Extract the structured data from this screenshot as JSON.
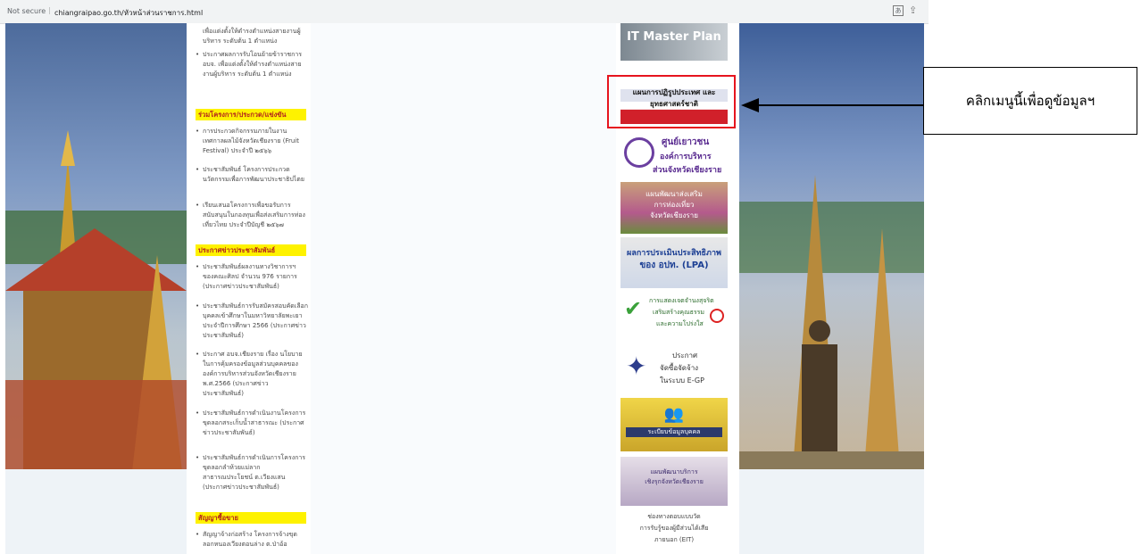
{
  "browser": {
    "security": "Not secure",
    "url": "chiangraipao.go.th/หัวหน้าส่วนราชการ.html"
  },
  "left_column": {
    "top_items": [
      "เพื่อแต่งตั้งให้ดำรงตำแหน่งสายงานผู้บริหาร ระดับต้น 1 ตำแหน่ง",
      "ประกาศผลการรับโอนย้ายข้าราชการ อบจ. เพื่อแต่งตั้งให้ดำรงตำแหน่งสายงานผู้บริหาร ระดับต้น 1 ตำแหน่ง"
    ],
    "section1": "ร่วมโครงการ/ประกวด/แข่งขัน",
    "section1_items": [
      "การประกวดกิจกรรมภายในงานเทศกาลผลไม้จังหวัดเชียงราย (Fruit Festival) ประจำปี ๒๕๖๖",
      "ประชาสัมพันธ์ โครงการประกวดนวัตกรรมเพื่อการพัฒนาประชาธิปไตย",
      "เรียนเสนอโครงการเพื่อขอรับการสนับสนุนในกองทุนเพื่อส่งเสริมการท่องเที่ยวไทย ประจำปีบัญชี ๒๕๖๗"
    ],
    "section2": "ประกาศข่าวประชาสัมพันธ์",
    "section2_items": [
      "ประชาสัมพันธ์ผลงานทางวิชาการฯ ของคณะศิลป จำนวน 976 รายการ (ประกาศข่าวประชาสัมพันธ์)",
      "ประชาสัมพันธ์การรับสมัครสอบคัดเลือกบุคคลเข้าศึกษาในมหาวิทยาลัยพะเยา ประจำปีการศึกษา 2566 (ประกาศข่าวประชาสัมพันธ์)",
      "ประกาศ อบจ.เชียงราย เรื่อง นโยบายในการคุ้มครองข้อมูลส่วนบุคคลขององค์การบริหารส่วนจังหวัดเชียงราย พ.ศ.2566 (ประกาศข่าวประชาสัมพันธ์)",
      "ประชาสัมพันธ์การดำเนินงานโครงการขุดลอกสระเก็บน้ำสาธารณะ (ประกาศข่าวประชาสัมพันธ์)",
      "ประชาสัมพันธ์การดำเนินการโครงการขุดลอกลำห้วยแม่ลาก สาธารณประโยชน์ ต.เวียงแสน (ประกาศข่าวประชาสัมพันธ์)"
    ],
    "section3": "สัญญาซื้อขาย",
    "section3_items": [
      "สัญญาจ้างก่อสร้าง โครงการจ้างขุดลอกหนองเวียงตอนล่าง ต.ป่าอ้อ"
    ]
  },
  "banners": {
    "it_master_plan": "IT Master Plan",
    "thai_flag": "แผนการปฏิรูปประเทศ และยุทธศาสตร์ชาติ",
    "youth_center": [
      "ศูนย์เยาวชน",
      "องค์การบริหาร",
      "ส่วนจังหวัดเชียงราย"
    ],
    "tourism_plan": [
      "แผนพัฒนาส่งเสริม",
      "การท่องเที่ยว",
      "จังหวัดเชียงราย"
    ],
    "lpa": [
      "ผลการประเมินประสิทธิภาพ",
      "ของ อปท. (LPA)"
    ],
    "anti_corruption": [
      "การแสดงเจตจำนงสุจริต",
      "เสริมสร้างคุณธรรม",
      "และความโปร่งใส"
    ],
    "egp": [
      "ประกาศ",
      "จัดซื้อจัดจ้าง",
      "ในระบบ E-GP"
    ],
    "personnel": "ระเบียบข้อมูลบุคคล",
    "public_service": [
      "แผนพัฒนาบริการ",
      "เชิงรุกจังหวัดเชียงราย"
    ],
    "eit": [
      "ช่องทางตอบแบบวัด",
      "การรับรู้ของผู้มีส่วนได้เสีย",
      "ภายนอก (EIT)"
    ]
  },
  "annotation": {
    "callout_text": "คลิกเมนูนี้เพื่อดูข้อมูลฯ",
    "arrow_color": "#000000",
    "highlight_color": "#e6141e"
  },
  "colors": {
    "section_bg": "#fef200",
    "section_text": "#b3231e"
  }
}
